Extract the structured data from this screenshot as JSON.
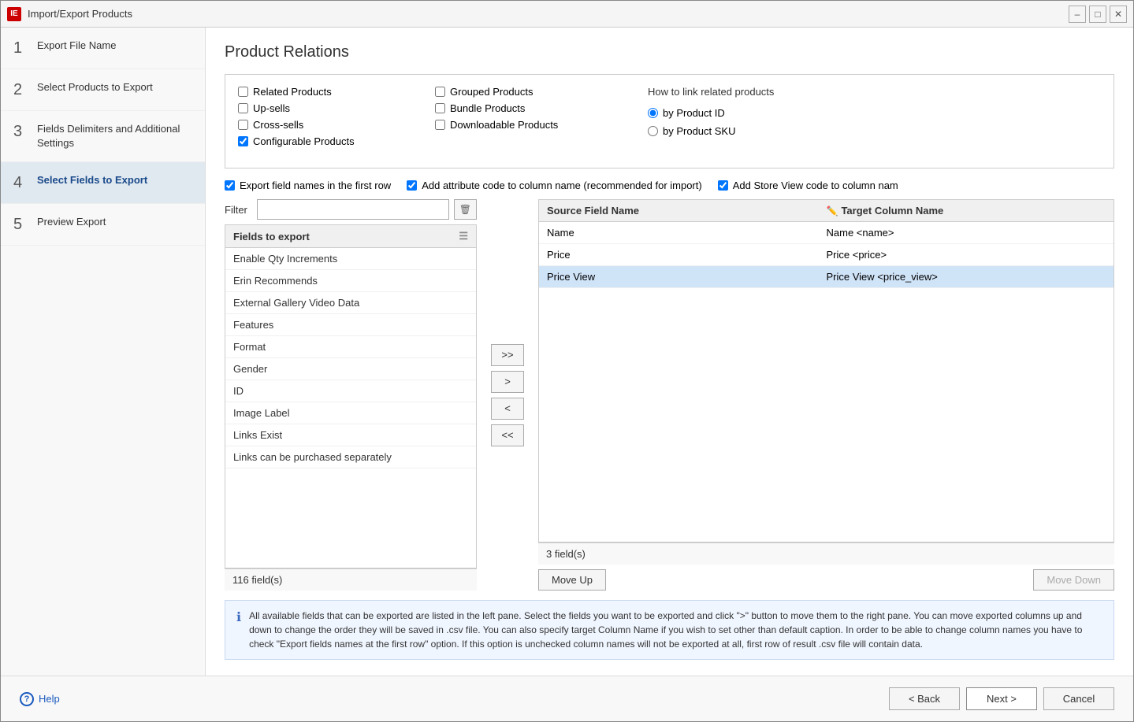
{
  "window": {
    "title": "Import/Export Products",
    "icon": "IE"
  },
  "sidebar": {
    "items": [
      {
        "step": "1",
        "label": "Export File Name",
        "active": false
      },
      {
        "step": "2",
        "label": "Select Products to Export",
        "active": false
      },
      {
        "step": "3",
        "label": "Fields Delimiters and Additional Settings",
        "active": false
      },
      {
        "step": "4",
        "label": "Select Fields to Export",
        "active": true
      },
      {
        "step": "5",
        "label": "Preview Export",
        "active": false
      }
    ]
  },
  "page": {
    "title": "Product Relations"
  },
  "product_relations": {
    "checkboxes": [
      {
        "label": "Related Products",
        "checked": false
      },
      {
        "label": "Up-sells",
        "checked": false
      },
      {
        "label": "Cross-sells",
        "checked": false
      },
      {
        "label": "Configurable Products",
        "checked": true
      }
    ],
    "checkboxes_right": [
      {
        "label": "Grouped Products",
        "checked": false
      },
      {
        "label": "Bundle Products",
        "checked": false
      },
      {
        "label": "Downloadable Products",
        "checked": false
      }
    ],
    "how_to_link": {
      "title": "How to link related products",
      "options": [
        {
          "label": "by Product ID",
          "selected": true
        },
        {
          "label": "by Product SKU",
          "selected": false
        }
      ]
    }
  },
  "options_bar": {
    "export_field_names": {
      "label": "Export field names in the  first row",
      "checked": true
    },
    "add_attribute_code": {
      "label": "Add attribute code to column name (recommended for import)",
      "checked": true
    },
    "add_store_view": {
      "label": "Add Store View code to column nam",
      "checked": true
    }
  },
  "fields_panel": {
    "filter_label": "Filter",
    "filter_placeholder": "",
    "fields_to_export_header": "Fields to export",
    "fields": [
      "Enable Qty Increments",
      "Erin Recommends",
      "External Gallery Video Data",
      "Features",
      "Format",
      "Gender",
      "ID",
      "Image Label",
      "Links Exist",
      "Links can be purchased separately"
    ],
    "fields_count": "116 field(s)"
  },
  "move_buttons": {
    "add_all": ">>",
    "add": ">",
    "remove": "<",
    "remove_all": "<<"
  },
  "target_panel": {
    "source_col": "Source Field Name",
    "target_col": "Target Column Name",
    "rows": [
      {
        "source": "Name",
        "target": "Name <name>",
        "selected": false
      },
      {
        "source": "Price",
        "target": "Price <price>",
        "selected": false
      },
      {
        "source": "Price View",
        "target": "Price View <price_view>",
        "selected": true
      }
    ],
    "count": "3 field(s)"
  },
  "move_row_buttons": {
    "move_up": "Move Up",
    "move_down": "Move Down"
  },
  "info_text": "All available fields that can be exported are listed in the left pane. Select the fields you want to be exported and click \">\" button to move them to the right pane. You can move exported columns up and down to change the order they will be saved in .csv file. You can also specify target Column Name if you wish to set other than default caption.\nIn order to be able to change column names you have to check \"Export fields names at the first row\" option. If this option is unchecked column names will not be exported at all, first row of result .csv file will contain data.",
  "bottom_bar": {
    "help": "Help",
    "back": "< Back",
    "next": "Next >",
    "cancel": "Cancel"
  }
}
